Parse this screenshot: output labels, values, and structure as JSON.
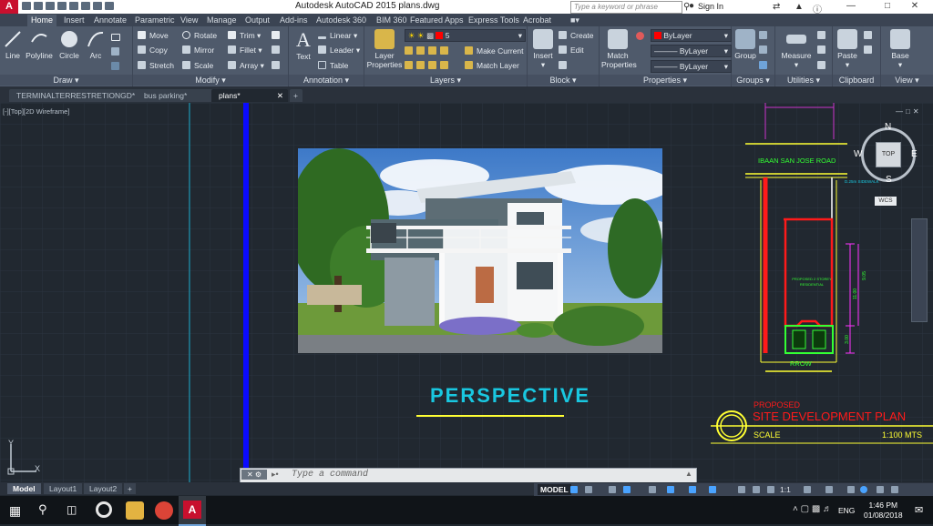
{
  "titlebar": {
    "app_title": "Autodesk AutoCAD 2015    plans.dwg",
    "search_placeholder": "Type a keyword or phrase",
    "signin_label": "Sign In"
  },
  "ribbon_tabs": [
    "Home",
    "Insert",
    "Annotate",
    "Parametric",
    "View",
    "Manage",
    "Output",
    "Add-ins",
    "Autodesk 360",
    "BIM 360",
    "Featured Apps",
    "Express Tools",
    "Acrobat"
  ],
  "panels": {
    "draw": {
      "title": "Draw",
      "line": "Line",
      "polyline": "Polyline",
      "circle": "Circle",
      "arc": "Arc"
    },
    "modify": {
      "title": "Modify",
      "move": "Move",
      "rotate": "Rotate",
      "trim": "Trim",
      "copy": "Copy",
      "mirror": "Mirror",
      "fillet": "Fillet",
      "stretch": "Stretch",
      "scale": "Scale",
      "array": "Array"
    },
    "annotation": {
      "title": "Annotation",
      "text": "Text",
      "linear": "Linear",
      "leader": "Leader",
      "table": "Table"
    },
    "layers": {
      "title": "Layers",
      "layer_properties": "Layer Properties",
      "current_layer": "5",
      "make_current": "Make Current",
      "match_layer": "Match Layer"
    },
    "block": {
      "title": "Block",
      "insert": "Insert",
      "create": "Create",
      "edit": "Edit"
    },
    "properties": {
      "title": "Properties",
      "match_properties": "Match Properties",
      "color": "ByLayer",
      "linetype": "ByLayer",
      "lineweight": "ByLayer"
    },
    "groups": {
      "title": "Groups",
      "group": "Group"
    },
    "utilities": {
      "title": "Utilities",
      "measure": "Measure"
    },
    "clipboard": {
      "title": "Clipboard",
      "paste": "Paste"
    },
    "view": {
      "title": "View",
      "base": "Base"
    }
  },
  "file_tabs": [
    "TERMINALTERRESTRETIONGD*",
    "bus parking*",
    "plans*"
  ],
  "viewport_label": "[-][Top][2D Wireframe]",
  "drawing": {
    "perspective_title": "PERSPECTIVE",
    "road_label": "IBAAN SAN JOSE ROAD",
    "building_label": "PROPOSED 2 STOREY RESIDENTIAL",
    "rrow_label": "RROW",
    "sitedev_proposed": "PROPOSED",
    "sitedev_title": "SITE DEVELOPMENT PLAN",
    "scale_label": "SCALE",
    "scale_value": "1:100 MTS",
    "dim_1": "11.00",
    "dim_2": "3.00",
    "dim_3": "9.05",
    "top_dim": "D.25m SIDEWALK"
  },
  "viewcube": {
    "north": "N",
    "south": "S",
    "east": "E",
    "west": "W",
    "top": "TOP",
    "wcs": "WCS"
  },
  "ucs": {
    "x": "X",
    "y": "Y"
  },
  "command": {
    "placeholder": "Type a command"
  },
  "layout_tabs": [
    "Model",
    "Layout1",
    "Layout2"
  ],
  "status": {
    "model": "MODEL",
    "scale": "1:1"
  },
  "taskbar": {
    "time": "1:46 PM",
    "date": "01/08/2018",
    "lang": "ENG"
  },
  "colors": {
    "ribbon": "#4f5a6b",
    "canvas": "#212830",
    "accent_cyan": "#19c7e0",
    "red": "#ff1a1a",
    "green": "#33ff33",
    "yellow": "#ffff33",
    "magenta": "#cc33cc",
    "blue_line": "#0a0aff"
  }
}
